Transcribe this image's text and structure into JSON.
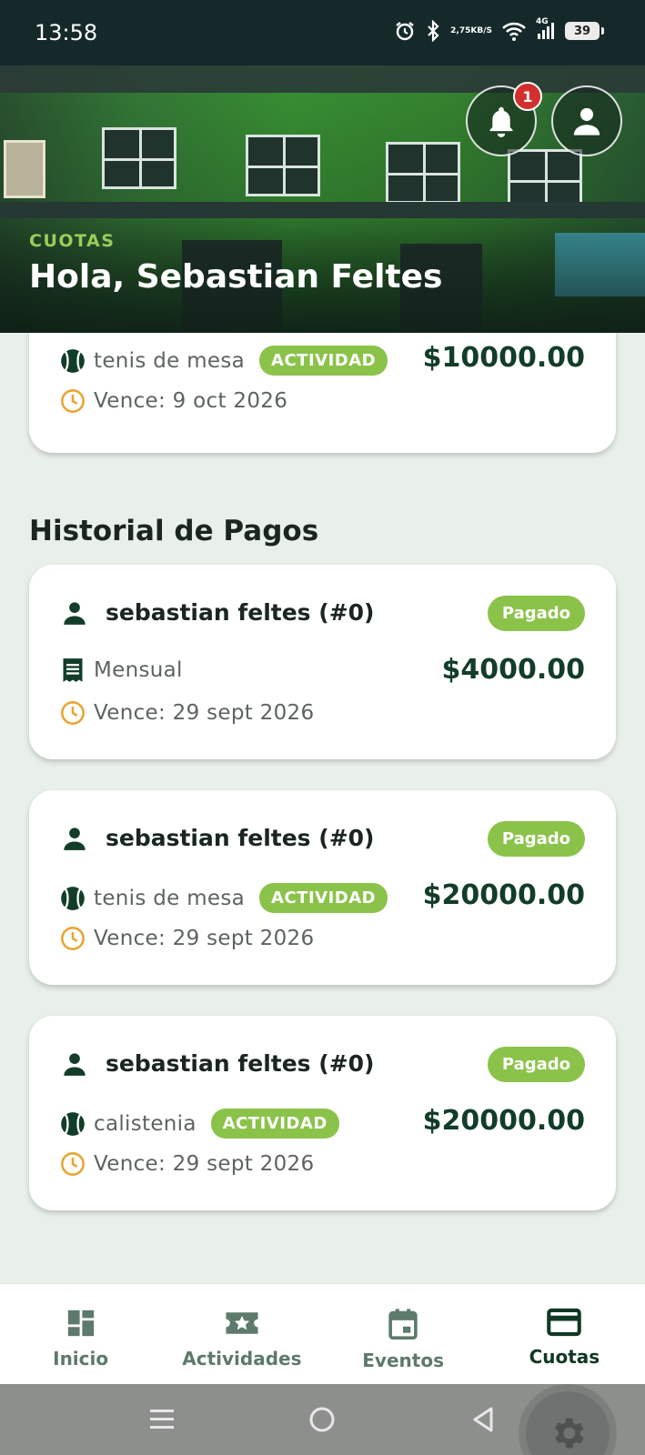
{
  "status_bar": {
    "time": "13:58",
    "net_speed_value": "2,75",
    "net_speed_unit": "KB/S",
    "network": "4G",
    "battery": "39"
  },
  "header": {
    "section_label": "CUOTAS",
    "greeting": "Hola, Sebastian Feltes",
    "notification_count": "1"
  },
  "pending_card": {
    "activity": "tenis de mesa",
    "chip": "ACTIVIDAD",
    "amount": "$10000.00",
    "due": "Vence: 9 oct 2026"
  },
  "history": {
    "title": "Historial de Pagos",
    "items": [
      {
        "member": "sebastian feltes (#0)",
        "status": "Pagado",
        "concept": "Mensual",
        "concept_type": "receipt",
        "chip": "",
        "amount": "$4000.00",
        "due": "Vence: 29 sept 2026"
      },
      {
        "member": "sebastian feltes (#0)",
        "status": "Pagado",
        "concept": "tenis de mesa",
        "concept_type": "activity",
        "chip": "ACTIVIDAD",
        "amount": "$20000.00",
        "due": "Vence: 29 sept 2026"
      },
      {
        "member": "sebastian feltes (#0)",
        "status": "Pagado",
        "concept": "calistenia",
        "concept_type": "activity",
        "chip": "ACTIVIDAD",
        "amount": "$20000.00",
        "due": "Vence: 29 sept 2026"
      }
    ]
  },
  "bottom_nav": {
    "items": [
      {
        "label": "Inicio",
        "icon": "dashboard-icon"
      },
      {
        "label": "Actividades",
        "icon": "ticket-star-icon"
      },
      {
        "label": "Eventos",
        "icon": "calendar-icon"
      },
      {
        "label": "Cuotas",
        "icon": "credit-card-icon",
        "active": true
      }
    ]
  },
  "colors": {
    "accent_green": "#8bc34a",
    "dark_green": "#123d28",
    "clock_orange": "#e8a534",
    "badge_red": "#d32f2f"
  }
}
